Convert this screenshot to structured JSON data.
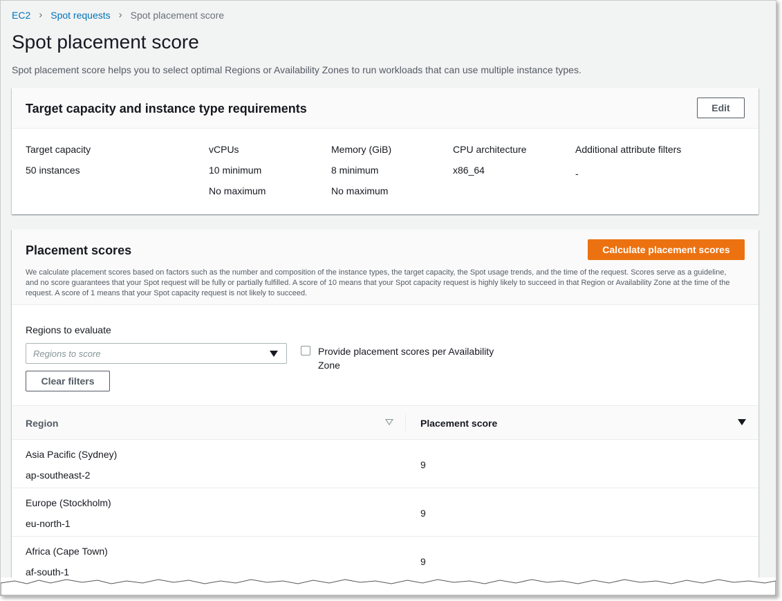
{
  "breadcrumb": {
    "items": [
      "EC2",
      "Spot requests"
    ],
    "current": "Spot placement score"
  },
  "page": {
    "title": "Spot placement score",
    "description": "Spot placement score helps you to select optimal Regions or Availability Zones to run workloads that can use multiple instance types."
  },
  "requirements": {
    "title": "Target capacity and instance type requirements",
    "edit_label": "Edit",
    "columns": [
      {
        "label": "Target capacity",
        "values": [
          "50 instances"
        ]
      },
      {
        "label": "vCPUs",
        "values": [
          "10 minimum",
          "No maximum"
        ]
      },
      {
        "label": "Memory (GiB)",
        "values": [
          "8 minimum",
          "No maximum"
        ]
      },
      {
        "label": "CPU architecture",
        "values": [
          "x86_64"
        ]
      },
      {
        "label": "Additional attribute filters",
        "values": [
          "-"
        ]
      }
    ]
  },
  "scores": {
    "title": "Placement scores",
    "calculate_label": "Calculate placement scores",
    "description": "We calculate placement scores based on factors such as the number and composition of the instance types, the target capacity, the Spot usage trends, and the time of the request. Scores serve as a guideline, and no score guarantees that your Spot request will be fully or partially fulfilled. A score of 10 means that your Spot capacity request is highly likely to succeed in that Region or Availability Zone at the time of the request. A score of 1 means that your Spot capacity request is not likely to succeed.",
    "regions_label": "Regions to evaluate",
    "regions_placeholder": "Regions to score",
    "az_checkbox_label": "Provide placement scores per Availability Zone",
    "clear_filters_label": "Clear filters",
    "table": {
      "headers": [
        "Region",
        "Placement score"
      ],
      "rows": [
        {
          "name": "Asia Pacific (Sydney)",
          "code": "ap-southeast-2",
          "score": "9"
        },
        {
          "name": "Europe (Stockholm)",
          "code": "eu-north-1",
          "score": "9"
        },
        {
          "name": "Africa (Cape Town)",
          "code": "af-south-1",
          "score": "9"
        }
      ]
    }
  },
  "colors": {
    "link": "#0073bb",
    "primary_button": "#ec7211"
  }
}
